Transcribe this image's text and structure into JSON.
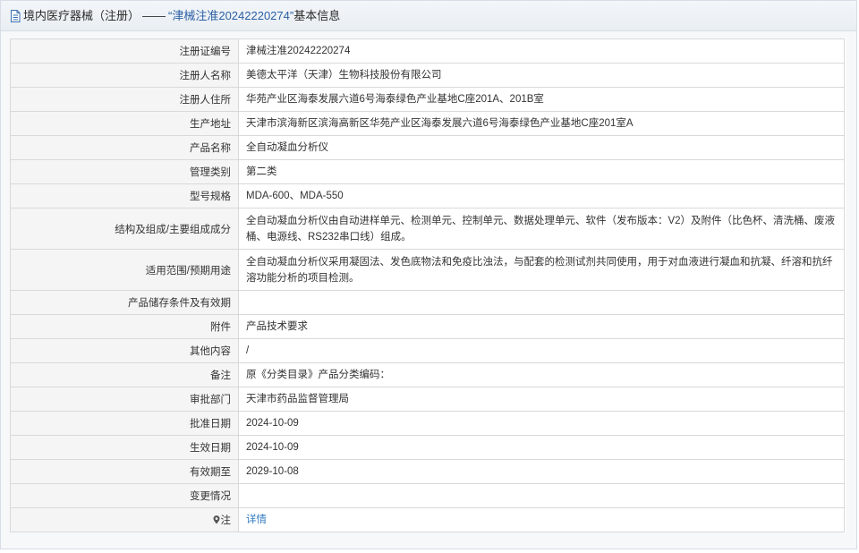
{
  "header": {
    "title_prefix": "境内医疗器械（注册）",
    "separator": "——",
    "reg_no_quoted": "“津械注准20242220274”",
    "title_suffix": "基本信息"
  },
  "rows": [
    {
      "label": "注册证编号",
      "value": "津械注准20242220274"
    },
    {
      "label": "注册人名称",
      "value": "美德太平洋（天津）生物科技股份有限公司"
    },
    {
      "label": "注册人住所",
      "value": "华苑产业区海泰发展六道6号海泰绿色产业基地C座201A、201B室"
    },
    {
      "label": "生产地址",
      "value": "天津市滨海新区滨海高新区华苑产业区海泰发展六道6号海泰绿色产业基地C座201室A"
    },
    {
      "label": "产品名称",
      "value": "全自动凝血分析仪"
    },
    {
      "label": "管理类别",
      "value": "第二类"
    },
    {
      "label": "型号规格",
      "value": "MDA-600、MDA-550"
    },
    {
      "label": "结构及组成/主要组成成分",
      "value": "全自动凝血分析仪由自动进样单元、检测单元、控制单元、数据处理单元、软件（发布版本：V2）及附件（比色杯、清洗桶、废液桶、电源线、RS232串口线）组成。"
    },
    {
      "label": "适用范围/预期用途",
      "value": "全自动凝血分析仪采用凝固法、发色底物法和免疫比浊法，与配套的检测试剂共同使用，用于对血液进行凝血和抗凝、纤溶和抗纤溶功能分析的项目检测。"
    },
    {
      "label": "产品储存条件及有效期",
      "value": ""
    },
    {
      "label": "附件",
      "value": "产品技术要求"
    },
    {
      "label": "其他内容",
      "value": "/"
    },
    {
      "label": "备注",
      "value": "原《分类目录》产品分类编码："
    },
    {
      "label": "审批部门",
      "value": "天津市药品监督管理局"
    },
    {
      "label": "批准日期",
      "value": "2024-10-09"
    },
    {
      "label": "生效日期",
      "value": "2024-10-09"
    },
    {
      "label": "有效期至",
      "value": "2029-10-08"
    },
    {
      "label": "变更情况",
      "value": ""
    }
  ],
  "note_row": {
    "label": "注",
    "link_text": "详情"
  },
  "icons": {
    "header": "document-icon",
    "note": "map-pin-icon"
  },
  "colors": {
    "link": "#2f7bc2",
    "title_accent": "#2b5fa5"
  }
}
